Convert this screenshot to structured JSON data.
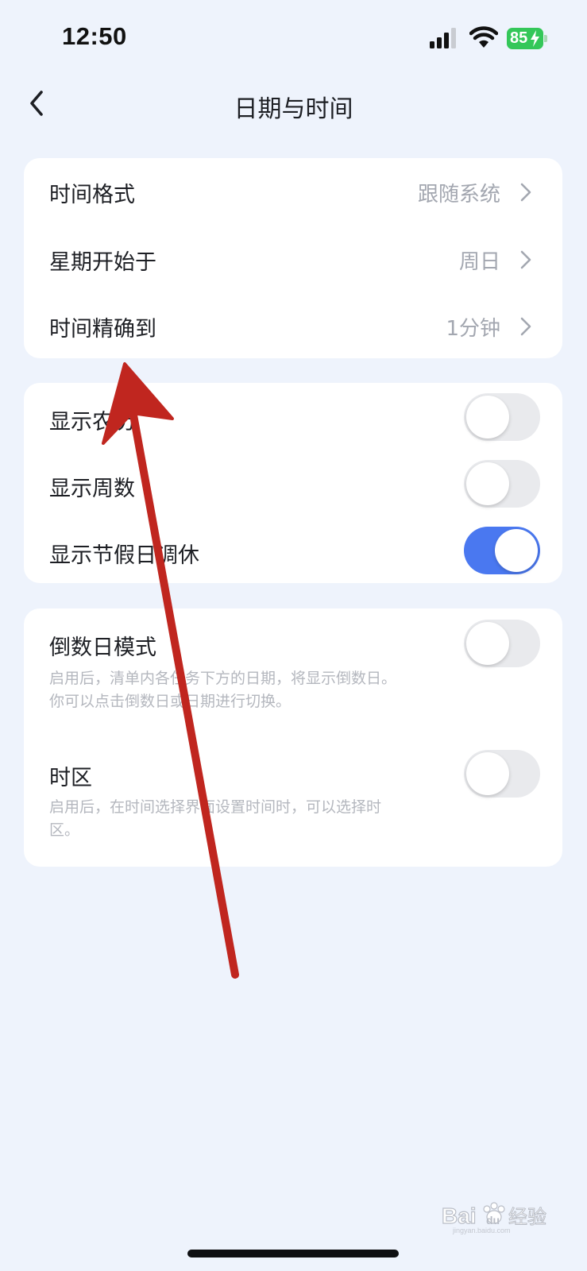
{
  "status_bar": {
    "time": "12:50",
    "battery": "85",
    "battery_color": "#34c759"
  },
  "nav": {
    "back_icon": "chevron-left-icon",
    "title": "日期与时间"
  },
  "group1": {
    "items": [
      {
        "label": "时间格式",
        "value": "跟随系统"
      },
      {
        "label": "星期开始于",
        "value": "周日"
      },
      {
        "label": "时间精确到",
        "value": "1分钟"
      }
    ]
  },
  "group2": {
    "items": [
      {
        "label": "显示农历",
        "on": false
      },
      {
        "label": "显示周数",
        "on": false
      },
      {
        "label": "显示节假日调休",
        "on": true
      }
    ]
  },
  "group3": {
    "items": [
      {
        "label": "倒数日模式",
        "on": false,
        "desc_lines": [
          "启用后，清单内各任务下方的日期，将显示倒数日。",
          "你可以点击倒数日或日期进行切换。"
        ]
      },
      {
        "label": "时区",
        "on": false,
        "desc_lines": [
          "启用后，在时间选择界面设置时间时，可以选择时",
          "区。"
        ]
      }
    ]
  },
  "colors": {
    "background": "#eef3fc",
    "card": "#ffffff",
    "toggle_on": "#4a78f0",
    "toggle_off": "#e9eaed",
    "annotation_arrow": "#c0261f"
  },
  "watermark": {
    "brand": "Baidu",
    "text": "经验",
    "domain": "jingyan.baidu.com"
  }
}
